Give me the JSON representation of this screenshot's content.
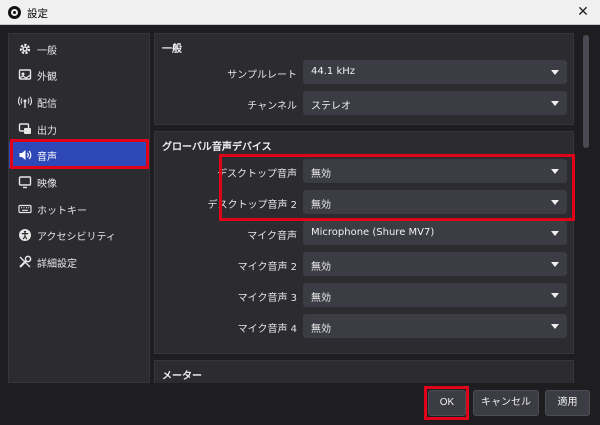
{
  "window": {
    "title": "設定",
    "close_glyph": "✕"
  },
  "sidebar": {
    "items": [
      {
        "label": "一般",
        "icon": "gear-icon"
      },
      {
        "label": "外観",
        "icon": "appearance-icon"
      },
      {
        "label": "配信",
        "icon": "broadcast-icon"
      },
      {
        "label": "出力",
        "icon": "output-icon"
      },
      {
        "label": "音声",
        "icon": "speaker-icon",
        "active": true
      },
      {
        "label": "映像",
        "icon": "monitor-icon"
      },
      {
        "label": "ホットキー",
        "icon": "keyboard-icon"
      },
      {
        "label": "アクセシビリティ",
        "icon": "accessibility-icon"
      },
      {
        "label": "詳細設定",
        "icon": "tools-icon"
      }
    ]
  },
  "general": {
    "title": "一般",
    "sample_rate_label": "サンプルレート",
    "sample_rate_value": "44.1 kHz",
    "channels_label": "チャンネル",
    "channels_value": "ステレオ"
  },
  "global_audio": {
    "title": "グローバル音声デバイス",
    "devices": [
      {
        "label": "デスクトップ音声",
        "value": "無効"
      },
      {
        "label": "デスクトップ音声 2",
        "value": "無効"
      },
      {
        "label": "マイク音声",
        "value": "Microphone (Shure MV7)"
      },
      {
        "label": "マイク音声 2",
        "value": "無効"
      },
      {
        "label": "マイク音声 3",
        "value": "無効"
      },
      {
        "label": "マイク音声 4",
        "value": "無効"
      }
    ]
  },
  "meters": {
    "title": "メーター"
  },
  "buttons": {
    "ok": "OK",
    "cancel": "キャンセル",
    "apply": "適用"
  },
  "colors": {
    "accent": "#2e48b8",
    "highlight": "#e0001a",
    "background": "#1e1e21",
    "panel": "#2b2b30",
    "combo": "#3b3c44"
  }
}
